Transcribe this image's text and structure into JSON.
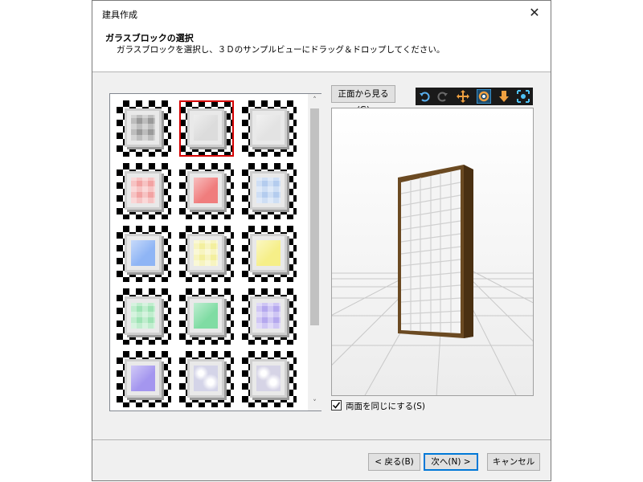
{
  "window": {
    "title": "建具作成",
    "close_glyph": "✕"
  },
  "header": {
    "title": "ガラスブロックの選択",
    "subtitle": "ガラスブロックを選択し、３Ｄのサンプルビューにドラッグ＆ドロップしてください。"
  },
  "grid": {
    "tiles": [
      {
        "color": "#9a9a9a",
        "pattern": "checker"
      },
      {
        "color": "#dcdcdc",
        "pattern": "plain",
        "selected": true
      },
      {
        "color": "#e3e3e3",
        "pattern": "plain"
      },
      {
        "color": "#f2a3a3",
        "pattern": "checker"
      },
      {
        "color": "#f07d7d",
        "pattern": "plain"
      },
      {
        "color": "#b4ccee",
        "pattern": "checker"
      },
      {
        "color": "#8fb5f5",
        "pattern": "plain"
      },
      {
        "color": "#f3ef9e",
        "pattern": "checker"
      },
      {
        "color": "#f6ef88",
        "pattern": "plain"
      },
      {
        "color": "#9ee3b4",
        "pattern": "checker"
      },
      {
        "color": "#7fdca3",
        "pattern": "plain"
      },
      {
        "color": "#b5a8ee",
        "pattern": "checker"
      },
      {
        "color": "#a496ef",
        "pattern": "plain"
      },
      {
        "color": "#d4d4e8",
        "pattern": "marble"
      },
      {
        "color": "#d6d4e6",
        "pattern": "marble"
      }
    ],
    "scroll_up": "˄",
    "scroll_down": "˅"
  },
  "viewer": {
    "front_view_button": "正面から見る(G)",
    "toolbar_icons": [
      "rotate-ccw-icon",
      "rotate-cw-icon",
      "move-icon",
      "orbit-icon",
      "drop-down-icon",
      "fit-view-icon"
    ],
    "checkbox_label": "両面を同じにする(S)",
    "checkbox_checked": true
  },
  "footer": {
    "back": "< 戻る(B)",
    "next": "次へ(N) >",
    "cancel": "キャンセル"
  }
}
